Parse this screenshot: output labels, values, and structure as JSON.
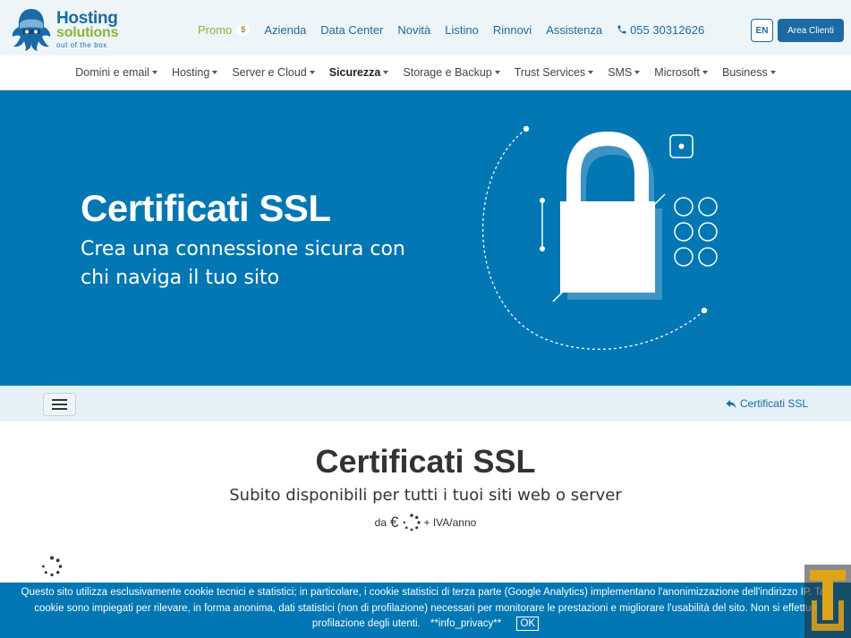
{
  "brand": {
    "name_line1": "Hosting",
    "name_line2": "solutions",
    "tagline": "out of the box"
  },
  "topnav": {
    "promo_label": "Promo",
    "promo_badge": "$",
    "items": [
      "Azienda",
      "Data Center",
      "Novità",
      "Listino",
      "Rinnovi",
      "Assistenza"
    ],
    "phone": "055 30312626",
    "lang_button": "EN",
    "area_button": "Area Clienti"
  },
  "mainnav": {
    "items": [
      "Domini e email",
      "Hosting",
      "Server e Cloud",
      "Sicurezza",
      "Storage e Backup",
      "Trust Services",
      "SMS",
      "Microsoft",
      "Business"
    ],
    "active": "Sicurezza"
  },
  "hero": {
    "title": "Certificati SSL",
    "subtitle": "Crea una connessione sicura con chi naviga il tuo sito"
  },
  "breadcrumb": {
    "current": "Certificati SSL"
  },
  "content": {
    "title": "Certificati SSL",
    "subtitle": "Subito disponibili per tutti i tuoi siti web o server",
    "price_prefix": "da",
    "currency": "€",
    "price_suffix": "+ IVA/anno"
  },
  "cookie": {
    "text": "Questo sito utilizza esclusivamente cookie tecnici e statistici; in particolare, i cookie statistici di terza parte (Google Analytics) implementano l'anonimizzazione dell'indirizzo IP. Tali cookie sono impiegati per rilevare, in forma anonima, dati statistici (non di profilazione) necessari per monitorare le prestazioni e migliorare l'usabilità del sito. Non si effettua profilazione degli utenti.",
    "link": "**info_privacy**",
    "ok_button": "OK"
  },
  "colors": {
    "brand_blue": "#0277b4",
    "link_blue": "#1b6aa5",
    "promo_green": "#8ab536",
    "topbar_bg": "#eef5f9"
  },
  "icons": {
    "logo": "octopus-mascot-icon",
    "phone": "phone-icon",
    "menu": "hamburger-icon",
    "breadcrumb": "reply-arrow-icon",
    "lock": "padlock-icon",
    "loading": "spinner-icon"
  }
}
